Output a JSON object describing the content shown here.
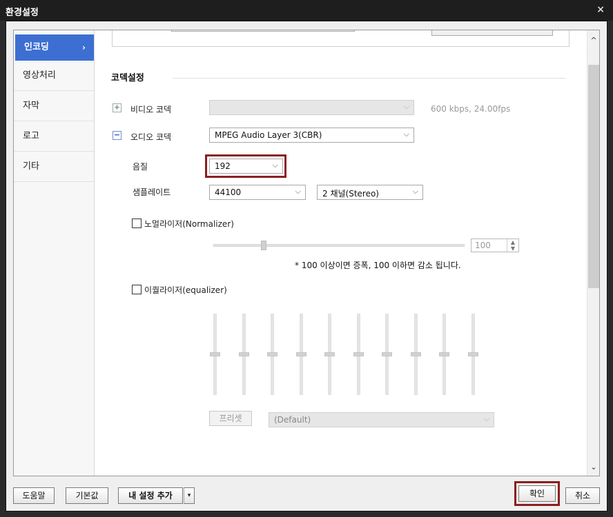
{
  "window": {
    "title": "환경설정",
    "close_glyph": "×"
  },
  "sidebar": {
    "items": [
      {
        "label": "인코딩",
        "active": true,
        "chevron": "›"
      },
      {
        "label": "영상처리"
      },
      {
        "label": "자막"
      },
      {
        "label": "로고"
      },
      {
        "label": "기타"
      }
    ]
  },
  "codec": {
    "section_title": "코덱설정",
    "video": {
      "toggle": "+",
      "label": "비디오 코덱",
      "value": "",
      "info": "600 kbps, 24.00fps"
    },
    "audio": {
      "toggle": "−",
      "label": "오디오 코덱",
      "value": "MPEG Audio Layer 3(CBR)"
    },
    "quality": {
      "label": "음질",
      "value": "192"
    },
    "samplerate": {
      "label": "샘플레이트",
      "value": "44100",
      "channel_value": "2 채널(Stereo)"
    },
    "normalizer": {
      "label": "노멀라이저(Normalizer)",
      "checked": false,
      "value": "100",
      "level": 0.2,
      "note": "* 100 이상이면 증폭, 100 이하면 감소 됩니다."
    },
    "equalizer": {
      "label": "이퀄라이저(equalizer)",
      "checked": false,
      "bands": [
        0.5,
        0.5,
        0.5,
        0.5,
        0.5,
        0.5,
        0.5,
        0.5,
        0.5,
        0.5
      ],
      "preset_button": "프리셋",
      "preset_value": "(Default)"
    }
  },
  "dropdown_arrow": "⌵",
  "scroll": {
    "up": "^",
    "down": "⌄"
  },
  "footer": {
    "help": "도움말",
    "default": "기본값",
    "add_setting": "내 설정 추가",
    "add_arrow": "▾",
    "ok": "확인",
    "cancel": "취소"
  },
  "colors": {
    "accent": "#3d6fd2",
    "highlight": "#8b1e1e"
  }
}
